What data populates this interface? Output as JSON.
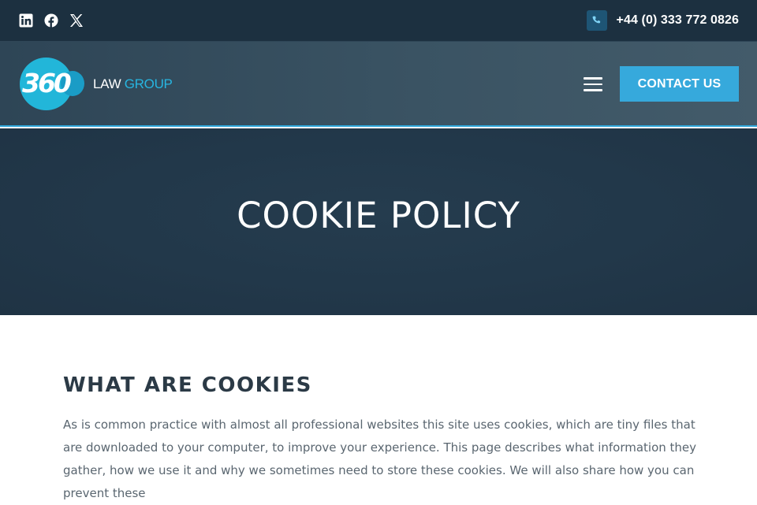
{
  "topbar": {
    "social": [
      {
        "name": "linkedin-icon"
      },
      {
        "name": "facebook-icon"
      },
      {
        "name": "x-icon"
      }
    ],
    "phone_icon": "phone-icon",
    "phone_number": "+44 (0) 333 772 0826"
  },
  "navbar": {
    "logo": {
      "mark": "360",
      "word1": "LAW",
      "word2": "GROUP"
    },
    "menu_icon": "hamburger-menu-icon",
    "contact_label": "CONTACT US"
  },
  "hero": {
    "title": "COOKIE POLICY"
  },
  "content": {
    "heading": "WHAT ARE COOKIES",
    "paragraph": "As is common practice with almost all professional websites this site uses cookies, which are tiny files that are downloaded to your computer, to improve your experience. This page describes what information they gather, how we use it and why we sometimes need to store these cookies. We will also share how you can prevent these"
  },
  "colors": {
    "topbar_bg": "#1c3040",
    "accent": "#36a9dc",
    "hero_bg": "#22384a",
    "heading": "#2b3a46",
    "body_text": "#5a6670"
  }
}
